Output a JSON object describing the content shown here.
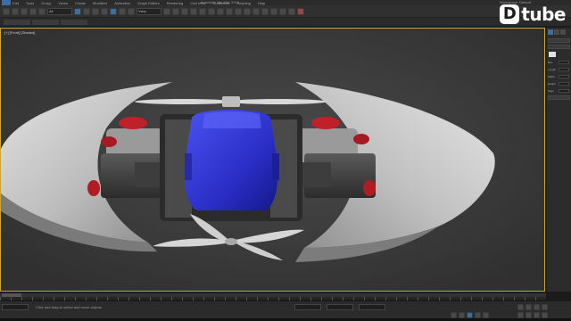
{
  "app": {
    "title": "Autodesk 3ds Max 2016",
    "workspace": "Workspace: Default"
  },
  "menu": [
    "Edit",
    "Tools",
    "Group",
    "Views",
    "Create",
    "Modifiers",
    "Animation",
    "Graph Editors",
    "Rendering",
    "Civil View",
    "Customize",
    "Scripting",
    "Help"
  ],
  "toolbar": {
    "selection_filter": "All",
    "reference_coord": "View"
  },
  "viewport": {
    "label": "[+] [Front] [Shaded]"
  },
  "watermark": {
    "mark": "D",
    "text": "tube"
  },
  "command_panel": {
    "rows": [
      "Box",
      "Length",
      "Width",
      "Height",
      "Segs"
    ]
  },
  "status": {
    "text": "Click and drag to select and move objects"
  },
  "colors": {
    "viewport_bg": "#3e3e3e",
    "selection_border": "#c8a53a",
    "body_blue": "#2b2fc8",
    "accent_red": "#c0202a",
    "shell_grey": "#c6c6c6"
  }
}
